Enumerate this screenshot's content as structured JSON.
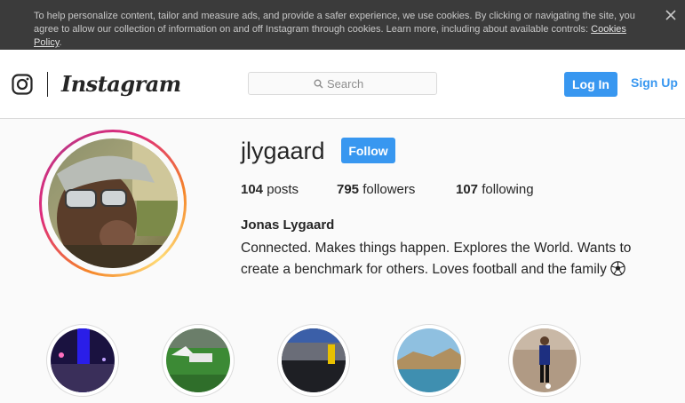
{
  "cookie_banner": {
    "text": "To help personalize content, tailor and measure ads, and provide a safer experience, we use cookies. By clicking or navigating the site, you agree to allow our collection of information on and off Instagram through cookies. Learn more, including about available controls: ",
    "link": "Cookies Policy",
    "suffix": "."
  },
  "header": {
    "brand": "Instagram",
    "search_placeholder": "Search",
    "login_label": "Log In",
    "signup_label": "Sign Up"
  },
  "profile": {
    "username": "jlygaard",
    "follow_label": "Follow",
    "stats": [
      {
        "value": "104",
        "label": " posts"
      },
      {
        "value": "795",
        "label": " followers"
      },
      {
        "value": "107",
        "label": " following"
      }
    ],
    "full_name": "Jonas Lygaard",
    "bio": "Connected. Makes things happen. Explores the World. Wants to create a benchmark for others. Loves football and the family"
  },
  "colors": {
    "accent": "#3897f0",
    "banner": "#3b3b3b",
    "border": "#dbdbdb"
  },
  "icons": [
    "close-icon",
    "instagram-glyph-icon",
    "search-icon",
    "football-emoji-icon"
  ]
}
